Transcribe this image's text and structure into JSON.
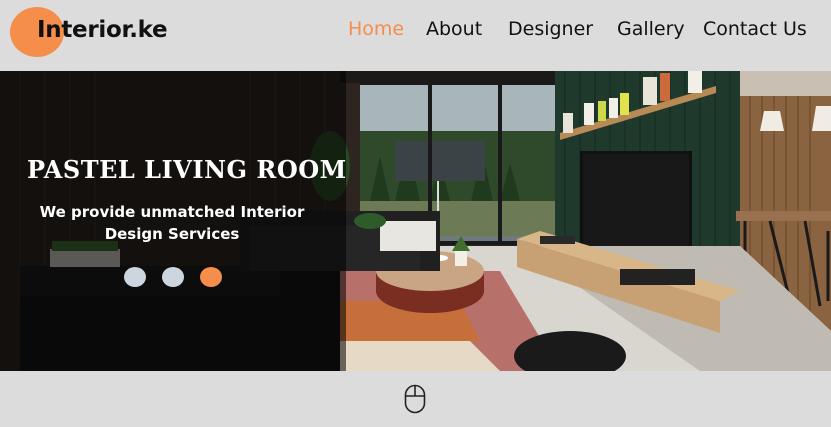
{
  "brand": {
    "name": "Interior.ke",
    "accent_color": "#f58d4b"
  },
  "nav": {
    "items": [
      {
        "label": "Home",
        "active": true
      },
      {
        "label": "About",
        "active": false
      },
      {
        "label": "Designer",
        "active": false
      },
      {
        "label": "Gallery",
        "active": false
      },
      {
        "label": "Contact Us",
        "active": false
      }
    ]
  },
  "hero": {
    "title": "PASTEL LIVING ROOM",
    "subtitle": "We provide unmatched Interior Design Services",
    "slides_count": 3,
    "active_slide": 3,
    "image_icon": "living-room-photo"
  },
  "scroll_indicator": {
    "icon": "mouse-icon"
  }
}
